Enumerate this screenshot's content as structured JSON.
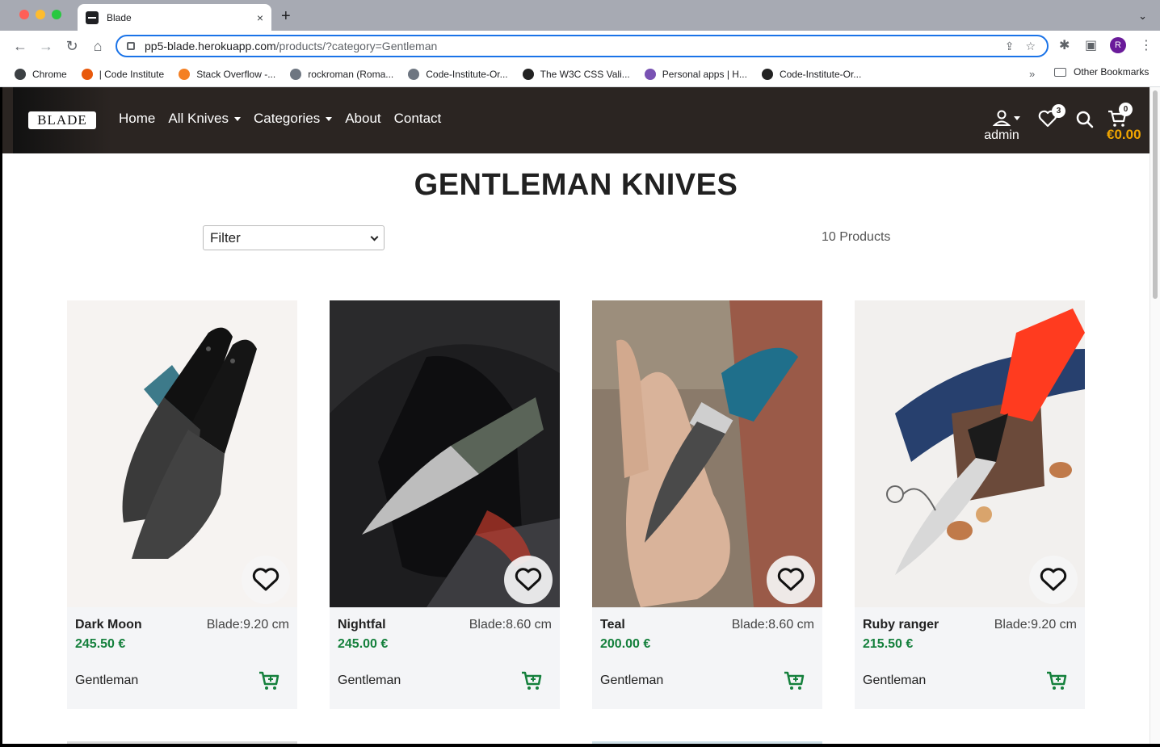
{
  "browser": {
    "tab_title": "Blade",
    "tab_close": "×",
    "new_tab": "+",
    "url_host": "pp5-blade.herokuapp.com",
    "url_rest": "/products/?category=Gentleman",
    "profile_initial": "R",
    "bookmarks": [
      {
        "label": "Chrome",
        "icon_color": "#3c4043"
      },
      {
        "label": "| Code Institute",
        "icon_color": "#e8590c"
      },
      {
        "label": "Stack Overflow -...",
        "icon_color": "#f48024"
      },
      {
        "label": "rockroman (Roma...",
        "icon_color": "#6e7681"
      },
      {
        "label": "Code-Institute-Or...",
        "icon_color": "#6e7681"
      },
      {
        "label": "The W3C CSS Vali...",
        "icon_color": "#222222"
      },
      {
        "label": "Personal apps | H...",
        "icon_color": "#7952b3"
      },
      {
        "label": "Code-Institute-Or...",
        "icon_color": "#222222"
      }
    ],
    "bookmarks_more": "»",
    "other_bookmarks": "Other Bookmarks"
  },
  "site": {
    "logo_text": "BLADE",
    "nav": [
      {
        "label": "Home",
        "dropdown": false
      },
      {
        "label": "All Knives",
        "dropdown": true
      },
      {
        "label": "Categories",
        "dropdown": true
      },
      {
        "label": "About",
        "dropdown": false
      },
      {
        "label": "Contact",
        "dropdown": false
      }
    ],
    "account_label": "admin",
    "wishlist_count": "3",
    "cart_count": "0",
    "cart_total": "€0.00",
    "accent_color": "#f0a500",
    "nav_bg": "#2b2522"
  },
  "main": {
    "title": "GENTLEMAN KNIVES",
    "filter_value": "Filter",
    "product_count": "10 Products"
  },
  "products": [
    {
      "name": "Dark Moon",
      "blade": "Blade:9.20 cm",
      "price": "245.50 €",
      "category": "Gentleman"
    },
    {
      "name": "Nightfal",
      "blade": "Blade:8.60 cm",
      "price": "245.00 €",
      "category": "Gentleman"
    },
    {
      "name": "Teal",
      "blade": "Blade:8.60 cm",
      "price": "200.00 €",
      "category": "Gentleman"
    },
    {
      "name": "Ruby ranger",
      "blade": "Blade:9.20 cm",
      "price": "215.50 €",
      "category": "Gentleman"
    }
  ],
  "colors": {
    "price": "#14803c",
    "cart_icon": "#14803c"
  }
}
